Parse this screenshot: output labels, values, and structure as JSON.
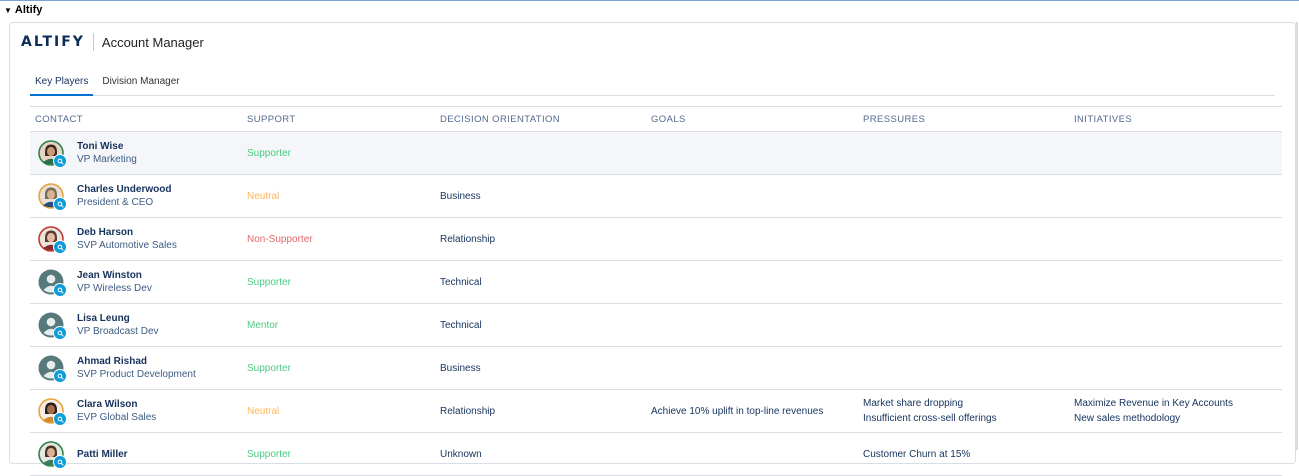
{
  "section": {
    "title": "Altify"
  },
  "header": {
    "logo_text": "ALTIFY",
    "app_title": "Account Manager"
  },
  "tabs": [
    {
      "label": "Key Players",
      "active": true
    },
    {
      "label": "Division Manager",
      "active": false
    }
  ],
  "table": {
    "columns": [
      "CONTACT",
      "SUPPORT",
      "DECISION ORIENTATION",
      "GOALS",
      "PRESSURES",
      "INITIATIVES"
    ],
    "rows": [
      {
        "name": "Toni Wise",
        "title": "VP Marketing",
        "support": "Supporter",
        "support_color": "#4bca81",
        "orientation": "",
        "goals": "",
        "pressures": [
          "",
          ""
        ],
        "initiatives": [
          "",
          ""
        ]
      },
      {
        "name": "Charles Underwood",
        "title": "President & CEO",
        "support": "Neutral",
        "support_color": "#ffb75d",
        "orientation": "Business",
        "goals": "",
        "pressures": [
          "",
          ""
        ],
        "initiatives": [
          "",
          ""
        ]
      },
      {
        "name": "Deb Harson",
        "title": "SVP Automotive Sales",
        "support": "Non-Supporter",
        "support_color": "#e4676a",
        "orientation": "Relationship",
        "goals": "",
        "pressures": [
          "",
          ""
        ],
        "initiatives": [
          "",
          ""
        ]
      },
      {
        "name": "Jean Winston",
        "title": "VP Wireless Dev",
        "support": "Supporter",
        "support_color": "#4bca81",
        "orientation": "Technical",
        "goals": "",
        "pressures": [
          "",
          ""
        ],
        "initiatives": [
          "",
          ""
        ]
      },
      {
        "name": "Lisa Leung",
        "title": "VP Broadcast Dev",
        "support": "Mentor",
        "support_color": "#4bca81",
        "orientation": "Technical",
        "goals": "",
        "pressures": [
          "",
          ""
        ],
        "initiatives": [
          "",
          ""
        ]
      },
      {
        "name": "Ahmad Rishad",
        "title": "SVP Product Development",
        "support": "Supporter",
        "support_color": "#4bca81",
        "orientation": "Business",
        "goals": "",
        "pressures": [
          "",
          ""
        ],
        "initiatives": [
          "",
          ""
        ]
      },
      {
        "name": "Clara Wilson",
        "title": "EVP Global Sales",
        "support": "Neutral",
        "support_color": "#ffb75d",
        "orientation": "Relationship",
        "goals": "Achieve 10% uplift in top-line revenues",
        "pressures": [
          "Market share dropping",
          "Insufficient cross-sell offerings"
        ],
        "initiatives": [
          "Maximize Revenue in Key Accounts",
          "New sales methodology"
        ]
      },
      {
        "name": "Patti Miller",
        "title": "",
        "support": "Supporter",
        "support_color": "#4bca81",
        "orientation": "Unknown",
        "goals": "",
        "pressures": [
          "Customer Churn at 15%",
          ""
        ],
        "initiatives": [
          "",
          ""
        ]
      }
    ]
  }
}
